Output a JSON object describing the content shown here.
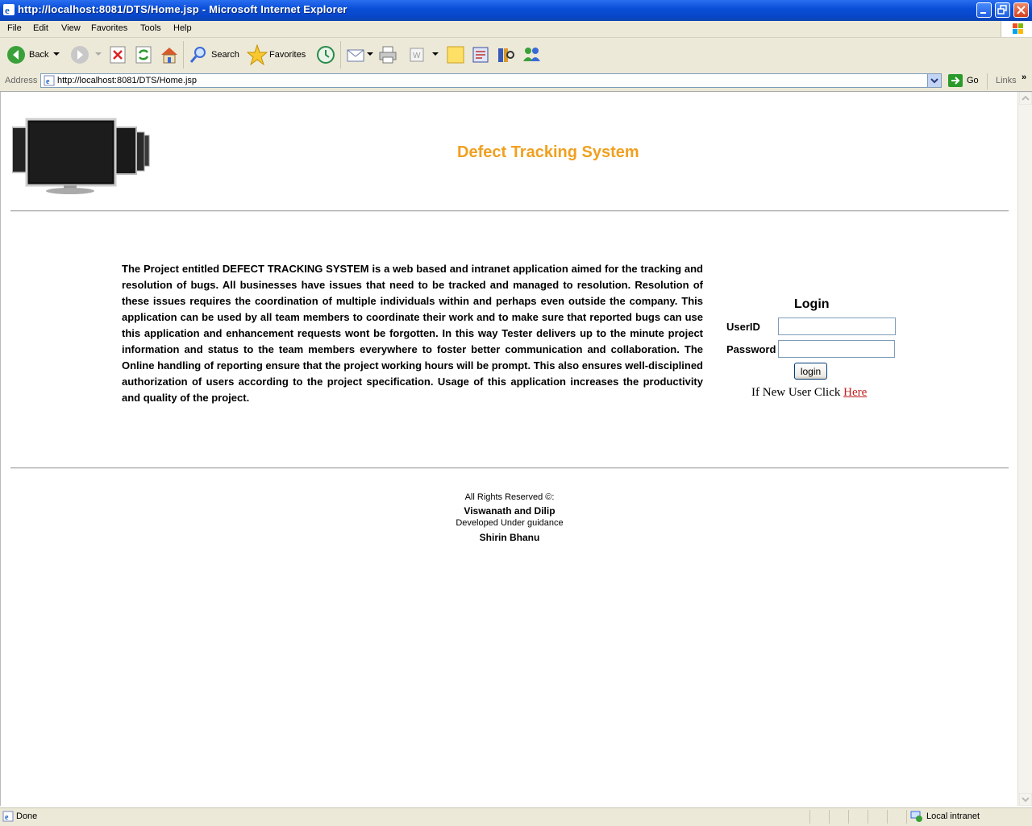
{
  "window": {
    "title": "http://localhost:8081/DTS/Home.jsp - Microsoft Internet Explorer"
  },
  "menu": [
    "File",
    "Edit",
    "View",
    "Favorites",
    "Tools",
    "Help"
  ],
  "toolbar": {
    "back_label": "Back",
    "search_label": "Search",
    "favorites_label": "Favorites"
  },
  "address_bar": {
    "label": "Address",
    "url": "http://localhost:8081/DTS/Home.jsp",
    "go_label": "Go",
    "links_label": "Links"
  },
  "page": {
    "site_title": "Defect Tracking System",
    "description": "The Project entitled DEFECT TRACKING SYSTEM is a web based and intranet application aimed for the tracking and resolution of bugs. All businesses have issues that need to be tracked and managed to resolution. Resolution of these issues requires the coordination of multiple individuals within and perhaps even outside the company. This application can be used by all team members to coordinate their work and to make sure that reported bugs can use this application and enhancement requests wont be forgotten. In this way Tester delivers up to the minute project information and status to the team members everywhere to foster better communication and collaboration. The Online handling of reporting ensure that the project working hours will be prompt. This also ensures well-disciplined authorization of users according to the project specification. Usage of this application increases the productivity and quality of the project.",
    "login": {
      "title": "Login",
      "userid_label": "UserID",
      "userid_value": "",
      "password_label": "Password",
      "password_value": "",
      "button_label": "login",
      "new_user_text": "If New User Click",
      "new_user_link": "Here"
    },
    "footer": {
      "rights": "All Rights Reserved ©:",
      "authors": "Viswanath and Dilip",
      "guidance": "Developed Under guidance",
      "guide": "Shirin Bhanu"
    }
  },
  "status_bar": {
    "status": "Done",
    "zone": "Local intranet"
  },
  "colors": {
    "title_orange": "#f0a020",
    "link_red": "#c02020",
    "xp_blue": "#0a4fd8",
    "chrome": "#ece9d8"
  }
}
